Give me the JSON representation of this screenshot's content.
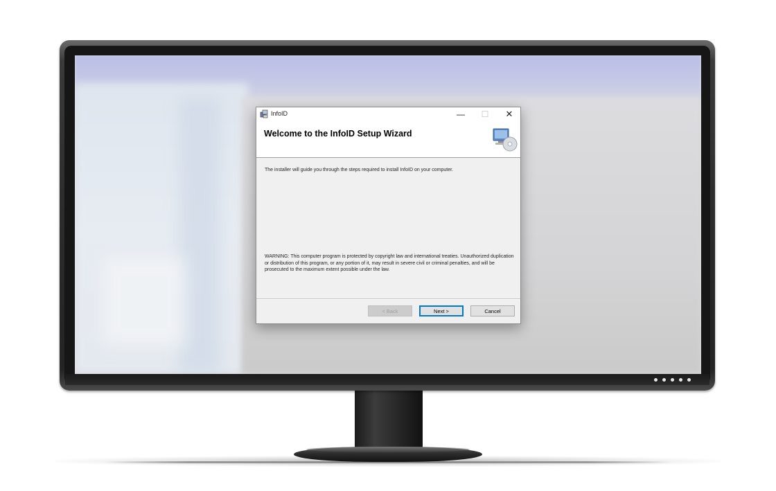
{
  "dialog": {
    "window_title": "InfoID",
    "header_title": "Welcome to the InfoID Setup Wizard",
    "titlebar": {
      "minimize_glyph": "—",
      "maximize_glyph": "☐",
      "close_glyph": "✕"
    },
    "intro_text": "The installer will guide you through the steps required to install InfoID on your computer.",
    "warning_text": "WARNING: This computer program is protected by copyright law and international treaties. Unauthorized duplication or distribution of this program, or any portion of it, may result in severe civil or criminal penalties, and will be prosecuted to the maximum extent possible under the law.",
    "buttons": {
      "back": "< Back",
      "next": "Next >",
      "cancel": "Cancel"
    }
  },
  "icons": {
    "app": "installer-app-icon",
    "wizard": "computer-cd-icon"
  },
  "colors": {
    "accent": "#0078d7",
    "dialog_bg": "#f0f0f0",
    "bezel": "#2c2c2c"
  }
}
